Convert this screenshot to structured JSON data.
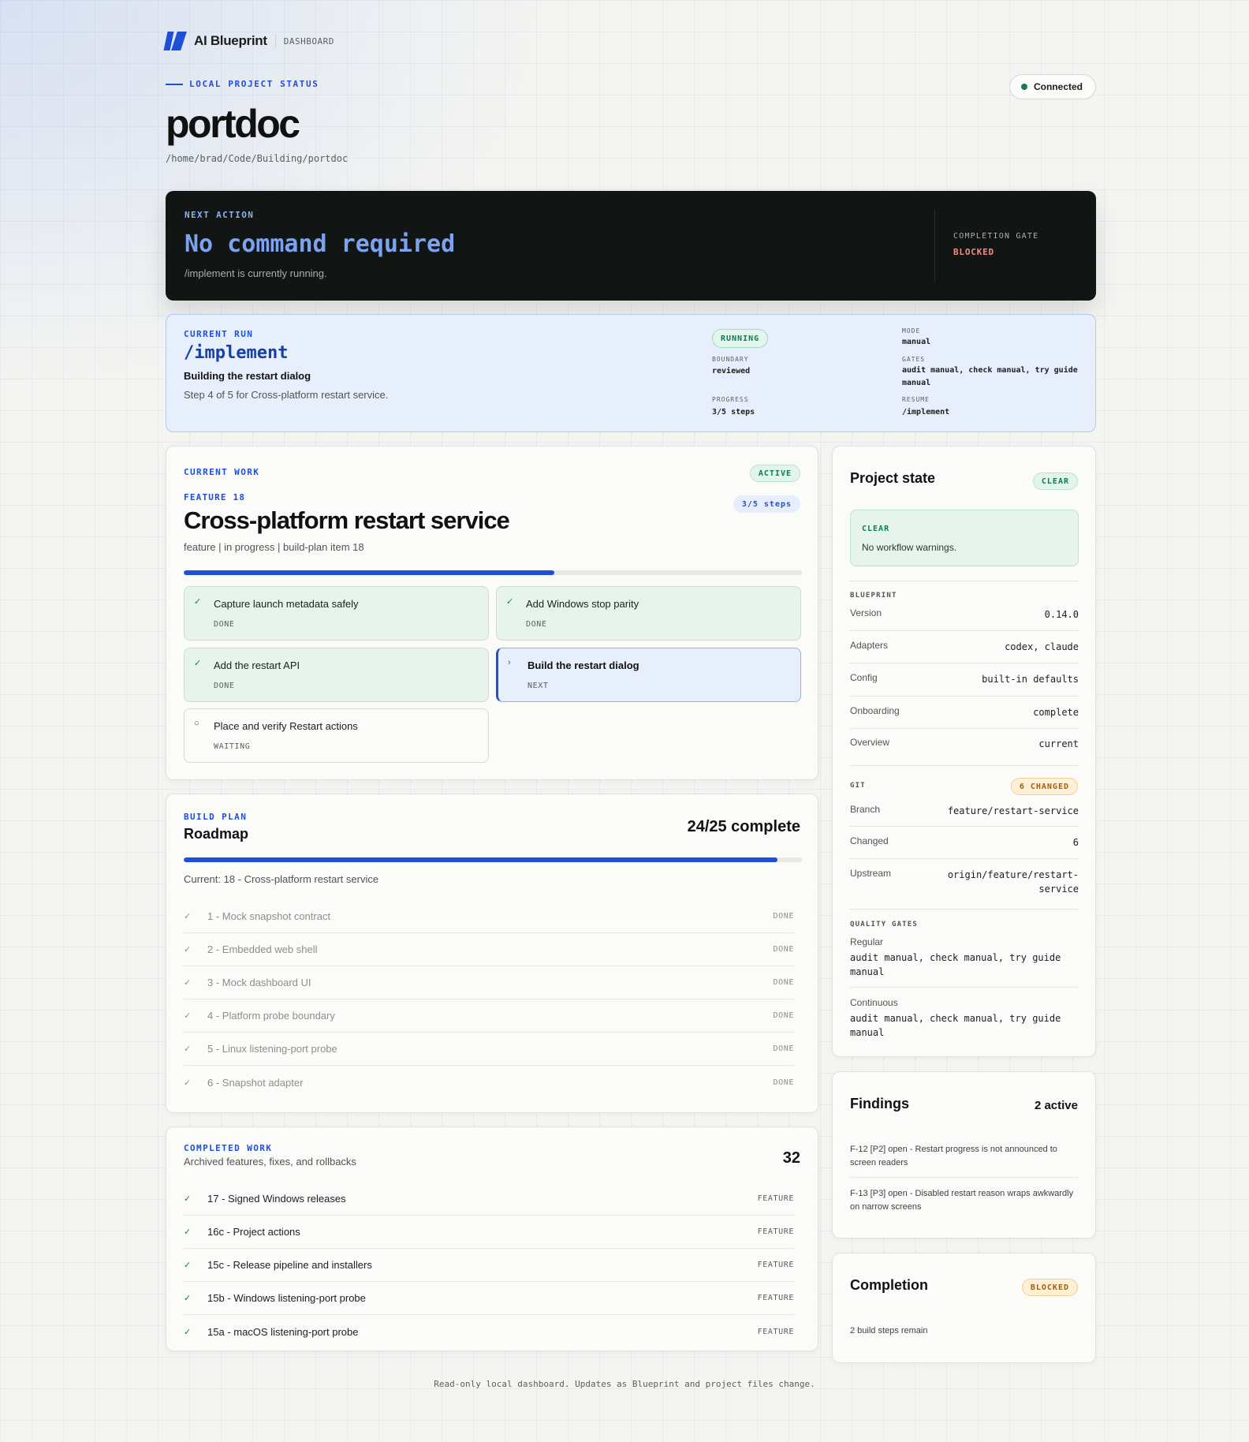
{
  "header": {
    "brand": "AI Blueprint",
    "section": "DASHBOARD",
    "eyebrow": "LOCAL PROJECT STATUS",
    "project_name": "portdoc",
    "project_path": "/home/brad/Code/Building/portdoc",
    "connection": "Connected"
  },
  "next_action": {
    "label": "NEXT ACTION",
    "command": "No command required",
    "note": "/implement is currently running.",
    "gate_label": "COMPLETION GATE",
    "gate_value": "BLOCKED"
  },
  "current_run": {
    "label": "CURRENT RUN",
    "command": "/implement",
    "title": "Building the restart dialog",
    "step": "Step 4 of 5 for Cross-platform restart service.",
    "status": "RUNNING",
    "boundary_label": "BOUNDARY",
    "boundary": "reviewed",
    "progress_label": "PROGRESS",
    "progress": "3/5 steps",
    "mode_label": "MODE",
    "mode": "manual",
    "gates_label": "GATES",
    "gates": "audit manual, check manual, try guide manual",
    "resume_label": "RESUME",
    "resume": "/implement"
  },
  "current_work": {
    "label": "CURRENT WORK",
    "status": "ACTIVE",
    "feature_label": "FEATURE 18",
    "steps_badge": "3/5 steps",
    "title": "Cross-platform restart service",
    "meta": "feature | in progress | build-plan item 18",
    "progress_fraction": 0.6,
    "steps": [
      {
        "title": "Capture launch metadata safely",
        "status": "DONE",
        "mark": "✓"
      },
      {
        "title": "Add Windows stop parity",
        "status": "DONE",
        "mark": "✓"
      },
      {
        "title": "Add the restart API",
        "status": "DONE",
        "mark": "✓"
      },
      {
        "title": "Build the restart dialog",
        "status": "NEXT",
        "mark": "›"
      },
      {
        "title": "Place and verify Restart actions",
        "status": "WAITING",
        "mark": "○"
      }
    ]
  },
  "build_plan": {
    "label": "BUILD PLAN",
    "title": "Roadmap",
    "count": "24/25 complete",
    "progress_fraction": 0.96,
    "current": "Current: 18 - Cross-platform restart service",
    "items": [
      {
        "mark": "✓",
        "title": "1 - Mock snapshot contract",
        "status": "DONE"
      },
      {
        "mark": "✓",
        "title": "2 - Embedded web shell",
        "status": "DONE"
      },
      {
        "mark": "✓",
        "title": "3 - Mock dashboard UI",
        "status": "DONE"
      },
      {
        "mark": "✓",
        "title": "4 - Platform probe boundary",
        "status": "DONE"
      },
      {
        "mark": "✓",
        "title": "5 - Linux listening-port probe",
        "status": "DONE"
      },
      {
        "mark": "✓",
        "title": "6 - Snapshot adapter",
        "status": "DONE"
      }
    ]
  },
  "completed_work": {
    "label": "COMPLETED WORK",
    "subtitle": "Archived features, fixes, and rollbacks",
    "count": "32",
    "items": [
      {
        "mark": "✓",
        "title": "17 - Signed Windows releases",
        "type": "FEATURE"
      },
      {
        "mark": "✓",
        "title": "16c - Project actions",
        "type": "FEATURE"
      },
      {
        "mark": "✓",
        "title": "15c - Release pipeline and installers",
        "type": "FEATURE"
      },
      {
        "mark": "✓",
        "title": "15b - Windows listening-port probe",
        "type": "FEATURE"
      },
      {
        "mark": "✓",
        "title": "15a - macOS listening-port probe",
        "type": "FEATURE"
      }
    ]
  },
  "project_state": {
    "title": "Project state",
    "status": "CLEAR",
    "box_label": "CLEAR",
    "box_text": "No workflow warnings.",
    "blueprint_label": "BLUEPRINT",
    "blueprint": [
      {
        "key": "Version",
        "value": "0.14.0"
      },
      {
        "key": "Adapters",
        "value": "codex, claude"
      },
      {
        "key": "Config",
        "value": "built-in defaults"
      },
      {
        "key": "Onboarding",
        "value": "complete"
      },
      {
        "key": "Overview",
        "value": "current"
      }
    ],
    "git_label": "GIT",
    "git_badge": "6 CHANGED",
    "git": [
      {
        "key": "Branch",
        "value": "feature/restart-service"
      },
      {
        "key": "Changed",
        "value": "6"
      },
      {
        "key": "Upstream",
        "value": "origin/feature/restart-\nservice"
      }
    ],
    "quality_label": "QUALITY GATES",
    "regular_label": "Regular",
    "regular": "audit manual, check manual, try guide manual",
    "continuous_label": "Continuous",
    "continuous": "audit manual, check manual, try guide manual"
  },
  "findings": {
    "title": "Findings",
    "count": "2 active",
    "items": [
      "F-12 [P2] open - Restart progress is not announced to screen readers",
      "F-13 [P3] open - Disabled restart reason wraps awkwardly on narrow screens"
    ]
  },
  "completion": {
    "title": "Completion",
    "status": "BLOCKED",
    "note": "2 build steps remain"
  },
  "footer": "Read-only local dashboard. Updates as Blueprint and project files change.",
  "colors": {
    "accent": "#1d4fd8",
    "success": "#157a55",
    "warning": "#a2600c",
    "danger": "#f28b8b",
    "dark_panel": "#111513"
  }
}
